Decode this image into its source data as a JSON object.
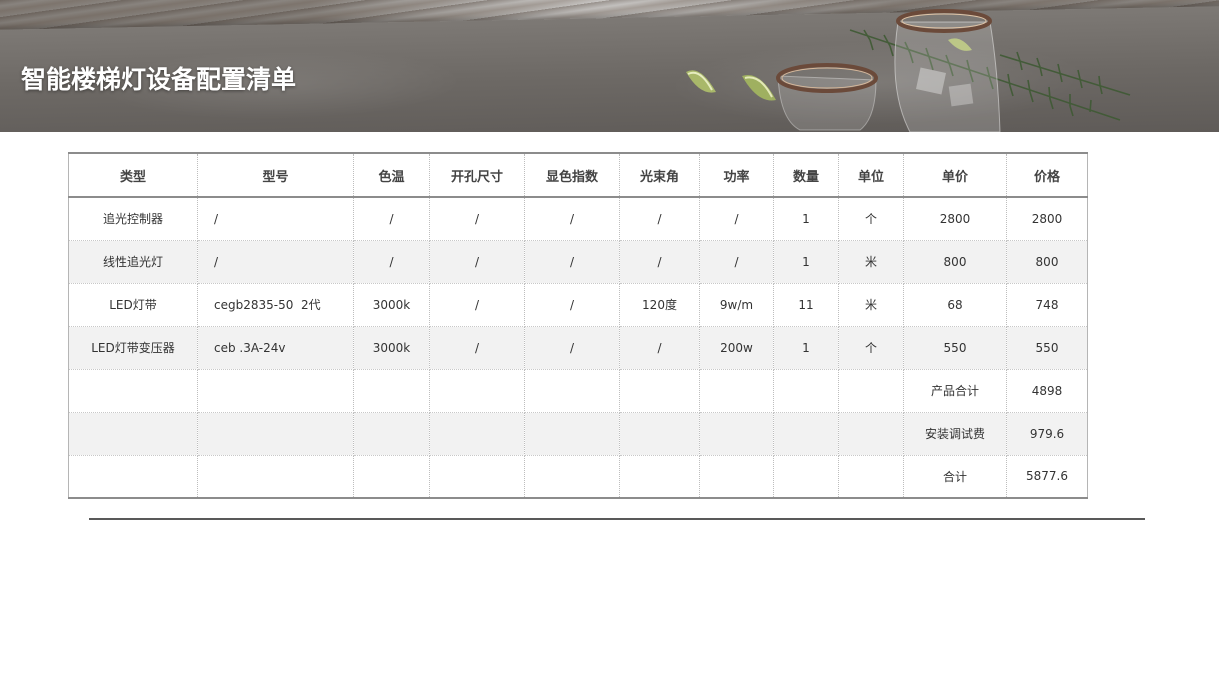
{
  "page": {
    "title": "智能楼梯灯设备配置清单"
  },
  "table": {
    "headers": [
      "类型",
      "型号",
      "色温",
      "开孔尺寸",
      "显色指数",
      "光束角",
      "功率",
      "数量",
      "单位",
      "单价",
      "价格"
    ],
    "rows": [
      [
        "追光控制器",
        "/",
        "/",
        "/",
        "/",
        "/",
        "/",
        "1",
        "个",
        "2800",
        "2800"
      ],
      [
        "线性追光灯",
        "/",
        "/",
        "/",
        "/",
        "/",
        "/",
        "1",
        "米",
        "800",
        "800"
      ],
      [
        "LED灯带",
        "cegb2835-50  2代",
        "3000k",
        "/",
        "/",
        "120度",
        "9w/m",
        "11",
        "米",
        "68",
        "748"
      ],
      [
        "LED灯带变压器",
        "ceb .3A-24v",
        "3000k",
        "/",
        "/",
        "/",
        "200w",
        "1",
        "个",
        "550",
        "550"
      ]
    ],
    "summary": [
      {
        "label": "产品合计",
        "value": "4898"
      },
      {
        "label": "安装调试费",
        "value": "979.6"
      },
      {
        "label": "合计",
        "value": "5877.6"
      }
    ]
  }
}
